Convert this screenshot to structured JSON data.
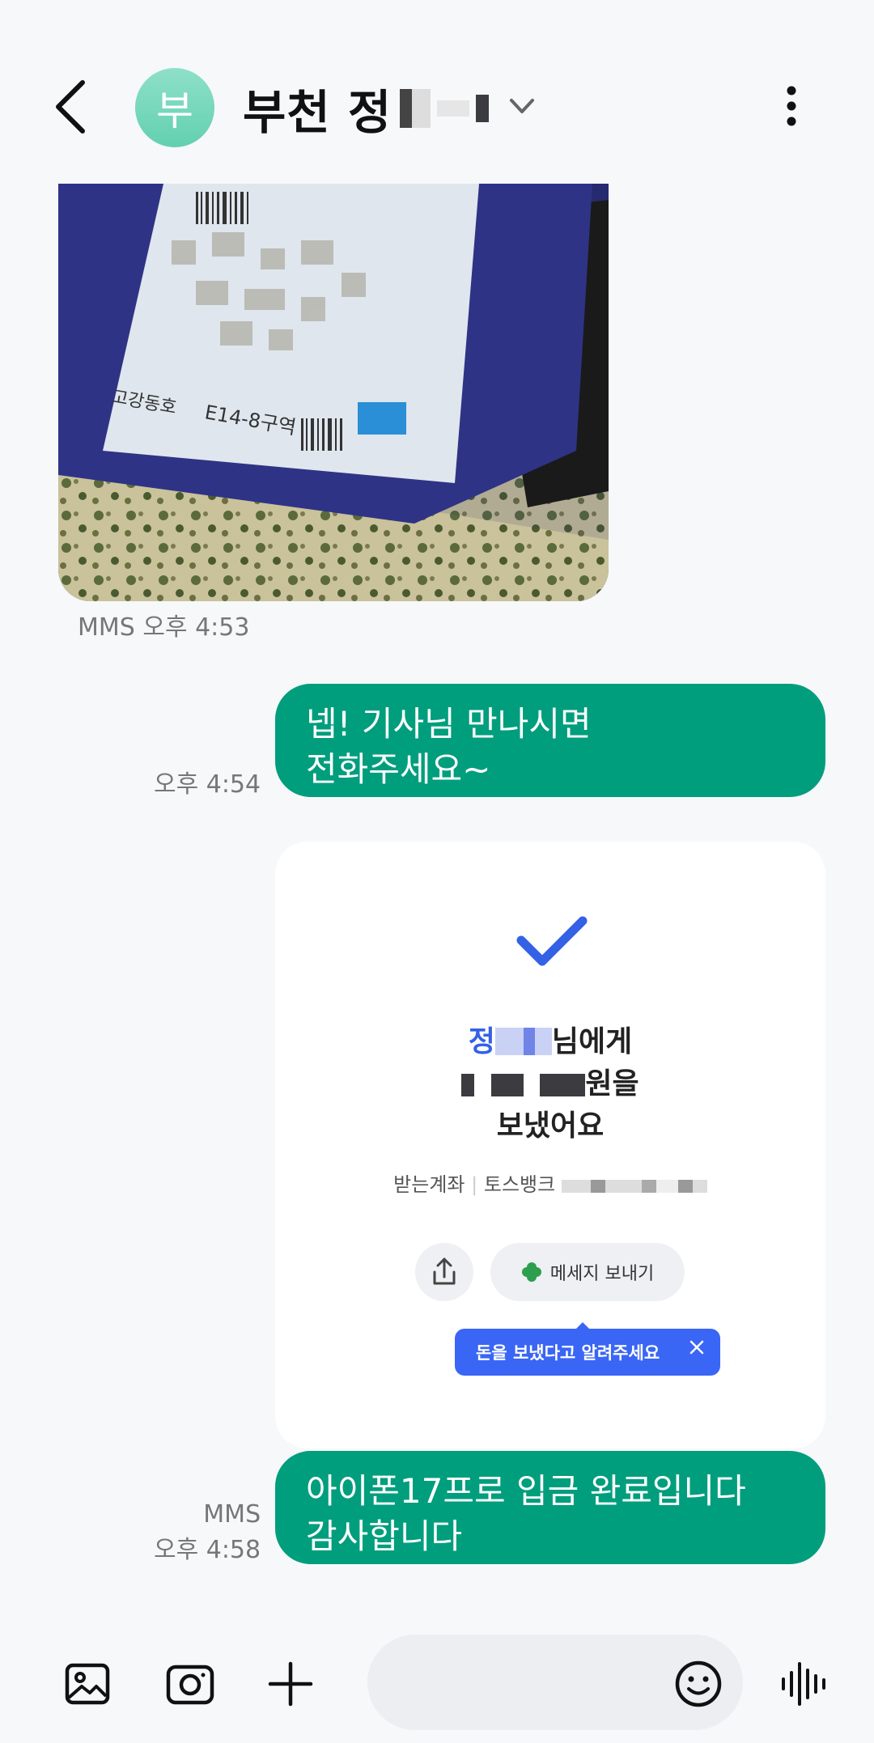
{
  "header": {
    "avatar_letter": "부",
    "contact_name": "부천 정"
  },
  "messages": {
    "mms1_meta": "MMS 오후 4:53",
    "bubble1_line1": "넵! 기사님 만나시면",
    "bubble1_line2": "전화주세요~",
    "bubble1_time": "오후 4:54",
    "bubble3_line1": "아이폰17프로 입금 완료입니다",
    "bubble3_line2": "감사합니다",
    "bubble3_meta_type": "MMS",
    "bubble3_time": "오후 4:58"
  },
  "toss_card": {
    "recipient_prefix": "정",
    "recipient_suffix": "님에게",
    "amount_suffix": "원을",
    "sent_text": "보냈어요",
    "account_label": "받는계좌",
    "bank_name": "토스뱅크",
    "send_message_label": "메세지 보내기",
    "tooltip_text": "돈을 보냈다고 알려주세요"
  },
  "colors": {
    "bubble_green": "#009e7d",
    "avatar_mint": "#6fd4b6",
    "toss_blue": "#3461e6"
  },
  "icons": [
    "back-arrow-icon",
    "chevron-down-icon",
    "more-vertical-icon",
    "checkmark-icon",
    "share-icon",
    "clover-icon",
    "close-icon",
    "gallery-icon",
    "camera-icon",
    "plus-icon",
    "emoji-icon",
    "voice-waveform-icon"
  ]
}
